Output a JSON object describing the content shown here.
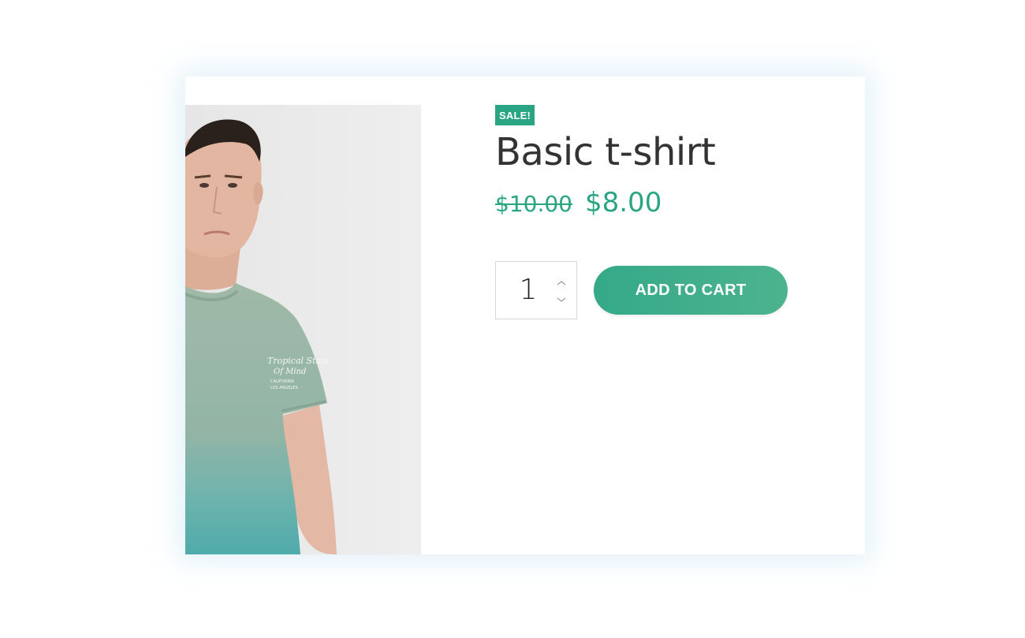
{
  "product": {
    "badge": "SALE!",
    "title": "Basic t-shirt",
    "regular_price": "$10.00",
    "sale_price": "$8.00",
    "image_alt": "Model wearing a sage-to-teal dip-dye t-shirt"
  },
  "cart": {
    "quantity": "1",
    "add_to_cart_label": "ADD TO CART"
  },
  "shirt_print": {
    "line1": "Tropical State",
    "line2": "Of Mind",
    "line3": "CALIFORNIA",
    "line4": "LOS ANGELES"
  },
  "colors": {
    "accent": "#2aa584",
    "button_start": "#35a988",
    "button_end": "#4db38f",
    "title_text": "#333333",
    "photo_background": "#ebebeb",
    "shirt_top": "#9db8a7",
    "shirt_bottom": "#56adab"
  },
  "icons": {
    "qty_up": "chevron-up-icon",
    "qty_down": "chevron-down-icon"
  }
}
